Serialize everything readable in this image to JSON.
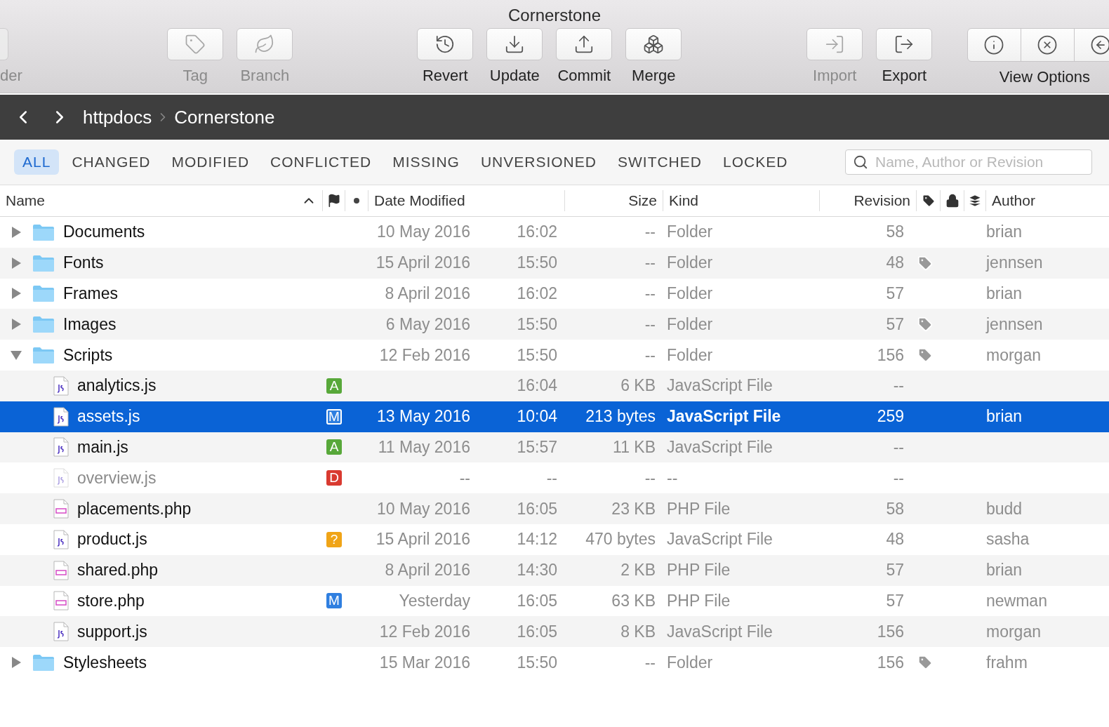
{
  "window": {
    "title": "Cornerstone"
  },
  "toolbar": {
    "groups": [
      [
        {
          "label": "der",
          "disabled": true
        }
      ],
      [
        {
          "label": "Tag",
          "disabled": true
        },
        {
          "label": "Branch",
          "disabled": true
        }
      ],
      [
        {
          "label": "Revert",
          "disabled": false
        },
        {
          "label": "Update",
          "disabled": false
        },
        {
          "label": "Commit",
          "disabled": false
        },
        {
          "label": "Merge",
          "disabled": false
        }
      ],
      [
        {
          "label": "Import",
          "disabled": true
        },
        {
          "label": "Export",
          "disabled": false
        }
      ]
    ],
    "view_options": {
      "label": "View Options"
    }
  },
  "path_bar": {
    "crumbs": [
      "httpdocs",
      "Cornerstone"
    ]
  },
  "filters": [
    {
      "label": "ALL",
      "selected": true
    },
    {
      "label": "CHANGED",
      "selected": false
    },
    {
      "label": "MODIFIED",
      "selected": false
    },
    {
      "label": "CONFLICTED",
      "selected": false
    },
    {
      "label": "MISSING",
      "selected": false
    },
    {
      "label": "UNVERSIONED",
      "selected": false
    },
    {
      "label": "SWITCHED",
      "selected": false
    },
    {
      "label": "LOCKED",
      "selected": false
    }
  ],
  "search": {
    "placeholder": "Name, Author or Revision"
  },
  "table": {
    "columns": [
      "Name",
      "Date Modified",
      "Size",
      "Kind",
      "Revision",
      "Author"
    ],
    "rows": [
      {
        "kind": "folder",
        "name": "Documents",
        "expanded": false,
        "date": "10 May 2016",
        "time": "16:02",
        "size": "--",
        "type": "Folder",
        "revision": "58",
        "tagged": false,
        "author": "brian",
        "selected": false,
        "dimmed": false
      },
      {
        "kind": "folder",
        "name": "Fonts",
        "expanded": false,
        "date": "15 April 2016",
        "time": "15:50",
        "size": "--",
        "type": "Folder",
        "revision": "48",
        "tagged": true,
        "author": "jennsen",
        "selected": false,
        "dimmed": false
      },
      {
        "kind": "folder",
        "name": "Frames",
        "expanded": false,
        "date": "8 April 2016",
        "time": "16:02",
        "size": "--",
        "type": "Folder",
        "revision": "57",
        "tagged": false,
        "author": "brian",
        "selected": false,
        "dimmed": false
      },
      {
        "kind": "folder",
        "name": "Images",
        "expanded": false,
        "date": "6 May 2016",
        "time": "15:50",
        "size": "--",
        "type": "Folder",
        "revision": "57",
        "tagged": true,
        "author": "jennsen",
        "selected": false,
        "dimmed": false
      },
      {
        "kind": "folder",
        "name": "Scripts",
        "expanded": true,
        "date": "12 Feb 2016",
        "time": "15:50",
        "size": "--",
        "type": "Folder",
        "revision": "156",
        "tagged": true,
        "author": "morgan",
        "selected": false,
        "dimmed": false,
        "children": [
          {
            "kind": "js",
            "name": "analytics.js",
            "status": {
              "text": "A",
              "color": "#58a83a"
            },
            "time": "16:04",
            "size": "6 KB",
            "type": "JavaScript File",
            "revision": "--",
            "tagged": false,
            "selected": false,
            "dimmed": false
          },
          {
            "kind": "js",
            "name": "assets.js",
            "status": {
              "text": "M",
              "color": "#2f7fe0"
            },
            "date": "13 May 2016",
            "time": "10:04",
            "size": "213 bytes",
            "type": "JavaScript File",
            "revision": "259",
            "tagged": false,
            "author": "brian",
            "selected": true,
            "dimmed": false
          },
          {
            "kind": "js",
            "name": "main.js",
            "status": {
              "text": "A",
              "color": "#58a83a"
            },
            "date": "11 May 2016",
            "time": "15:57",
            "size": "11 KB",
            "type": "JavaScript File",
            "revision": "--",
            "tagged": false,
            "selected": false,
            "dimmed": false
          },
          {
            "kind": "js",
            "name": "overview.js",
            "status": {
              "text": "D",
              "color": "#d93a30"
            },
            "date": "--",
            "time": "--",
            "size": "--",
            "type": "--",
            "revision": "--",
            "tagged": false,
            "selected": false,
            "dimmed": true
          },
          {
            "kind": "php",
            "name": "placements.php",
            "date": "10 May 2016",
            "time": "16:05",
            "size": "23 KB",
            "type": "PHP File",
            "revision": "58",
            "tagged": false,
            "author": "budd",
            "selected": false,
            "dimmed": false
          },
          {
            "kind": "js",
            "name": "product.js",
            "status": {
              "text": "?",
              "color": "#f0a417"
            },
            "date": "15 April 2016",
            "time": "14:12",
            "size": "470 bytes",
            "type": "JavaScript File",
            "revision": "48",
            "tagged": false,
            "author": "sasha",
            "selected": false,
            "dimmed": false
          },
          {
            "kind": "php",
            "name": "shared.php",
            "date": "8 April 2016",
            "time": "14:30",
            "size": "2 KB",
            "type": "PHP File",
            "revision": "57",
            "tagged": false,
            "author": "brian",
            "selected": false,
            "dimmed": false
          },
          {
            "kind": "php",
            "name": "store.php",
            "status": {
              "text": "M",
              "color": "#2f7fe0"
            },
            "date": "Yesterday",
            "time": "16:05",
            "size": "63 KB",
            "type": "PHP File",
            "revision": "57",
            "tagged": false,
            "author": "newman",
            "selected": false,
            "dimmed": false
          },
          {
            "kind": "js",
            "name": "support.js",
            "date": "12 Feb 2016",
            "time": "16:05",
            "size": "8 KB",
            "type": "JavaScript File",
            "revision": "156",
            "tagged": false,
            "author": "morgan",
            "selected": false,
            "dimmed": false
          }
        ]
      },
      {
        "kind": "folder",
        "name": "Stylesheets",
        "expanded": false,
        "date": "15 Mar 2016",
        "time": "15:50",
        "size": "--",
        "type": "Folder",
        "revision": "156",
        "tagged": true,
        "author": "frahm",
        "selected": false,
        "dimmed": false
      }
    ]
  }
}
